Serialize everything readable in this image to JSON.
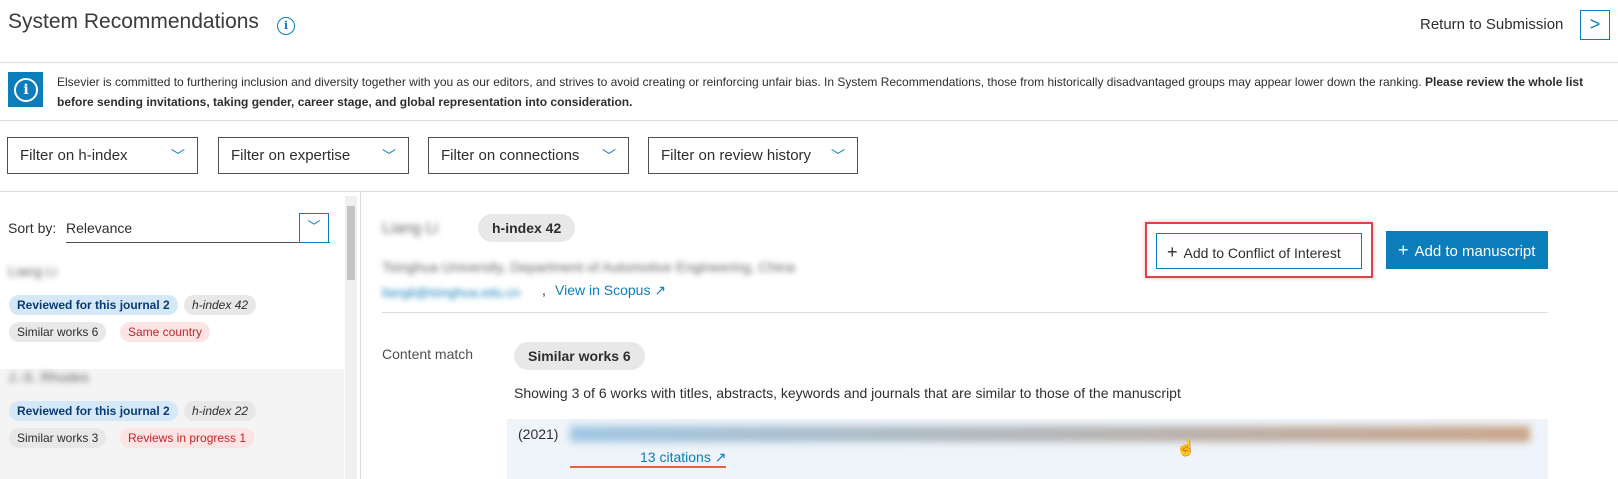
{
  "header": {
    "title": "System Recommendations",
    "info_icon": "i",
    "return_label": "Return to Submission",
    "return_chevron": ">"
  },
  "notice": {
    "icon": "i",
    "text": "Elsevier is committed to furthering inclusion and diversity together with you as our editors, and strives to avoid creating or reinforcing unfair bias. In System Recommendations, those from historically disadvantaged groups may appear lower down the ranking.",
    "bold_text": "Please review the whole list before sending invitations, taking gender, career stage, and global representation into consideration."
  },
  "filters": [
    {
      "label": "Filter on h-index"
    },
    {
      "label": "Filter on expertise"
    },
    {
      "label": "Filter on connections"
    },
    {
      "label": "Filter on review history"
    }
  ],
  "sort": {
    "label": "Sort by:",
    "value": "Relevance"
  },
  "candidates": [
    {
      "name_blurred": "Liang Li",
      "badges": [
        "Reviewed for this journal 2",
        "h-index 42",
        "Similar works 6",
        "Same country"
      ]
    },
    {
      "name_blurred": "J.-S. Rhodes",
      "badges": [
        "Reviewed for this journal 2",
        "h-index 22",
        "Similar works 3",
        "Reviews in progress 1"
      ]
    }
  ],
  "detail": {
    "name_blurred": "Liang Li",
    "hindex": "h-index 42",
    "affiliation_blurred": "Tsinghua University, Department of Automotive Engineering, China",
    "email_blurred": "liangli@tsinghua.edu.cn",
    "comma": ",",
    "scopus_link": "View in Scopus ↗",
    "coi_button": "Add to Conflict of Interest",
    "add_button": "Add to manuscript",
    "content_match_label": "Content match",
    "similar_badge": "Similar works 6",
    "showing_text": "Showing 3 of 6 works with titles, abstracts, keywords and journals that are similar to those of the manuscript",
    "works": [
      {
        "year": "(2021)",
        "citations": "13 citations ↗"
      }
    ]
  },
  "colors": {
    "accent": "#0c7dbb",
    "highlight": "#e0404a"
  }
}
